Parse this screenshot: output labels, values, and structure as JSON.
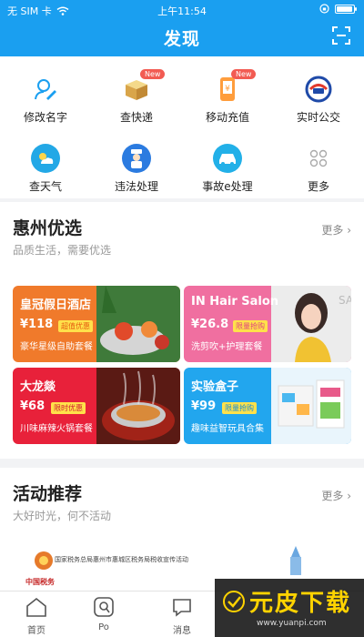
{
  "status_bar": {
    "carrier": "无 SIM 卡",
    "time": "上午11:54"
  },
  "header": {
    "title": "发现"
  },
  "services": [
    {
      "label": "修改名字",
      "icon": "edit-name-icon"
    },
    {
      "label": "查快递",
      "icon": "express-box-icon",
      "badge": "New"
    },
    {
      "label": "移动充值",
      "icon": "mobile-recharge-icon",
      "badge": "New"
    },
    {
      "label": "实时公交",
      "icon": "bus-icon"
    },
    {
      "label": "查天气",
      "icon": "weather-icon"
    },
    {
      "label": "违法处理",
      "icon": "traffic-police-icon"
    },
    {
      "label": "事故e处理",
      "icon": "car-accident-icon"
    },
    {
      "label": "更多",
      "icon": "more-grid-icon"
    }
  ],
  "featured": {
    "title": "惠州优选",
    "subtitle": "品质生活，需要优选",
    "more": "更多",
    "cards": [
      {
        "title": "皇冠假日酒店",
        "price": "¥118",
        "tag": "超值优惠",
        "desc": "豪华星级自助套餐",
        "color": "#f07a2b"
      },
      {
        "title": "IN Hair Salon",
        "price": "¥26.8",
        "tag": "限量抢购",
        "desc": "洗剪吹+护理套餐",
        "color": "#f06fa0"
      },
      {
        "title": "大龙燚",
        "price": "¥68",
        "tag": "限时优惠",
        "desc": "川味麻辣火锅套餐",
        "color": "#e8213a"
      },
      {
        "title": "实验盒子",
        "price": "¥99",
        "tag": "限量抢购",
        "desc": "趣味益智玩具合集",
        "color": "#22a6ee"
      }
    ]
  },
  "activities": {
    "title": "活动推荐",
    "subtitle": "大好时光，何不活动",
    "more": "更多",
    "banner_text": "国家税务总局惠州市惠城区税务局税收宣传活动",
    "banner_logo": "中国税务"
  },
  "tabbar": [
    {
      "label": "首页",
      "icon": "home-icon"
    },
    {
      "label": "Po",
      "icon": "po-icon"
    },
    {
      "label": "消息",
      "icon": "message-icon"
    }
  ],
  "watermark": {
    "main": "元皮下载",
    "sub": "www.yuanpi.com"
  },
  "colors": {
    "primary": "#1a9ff0",
    "badge": "#f25b52"
  }
}
